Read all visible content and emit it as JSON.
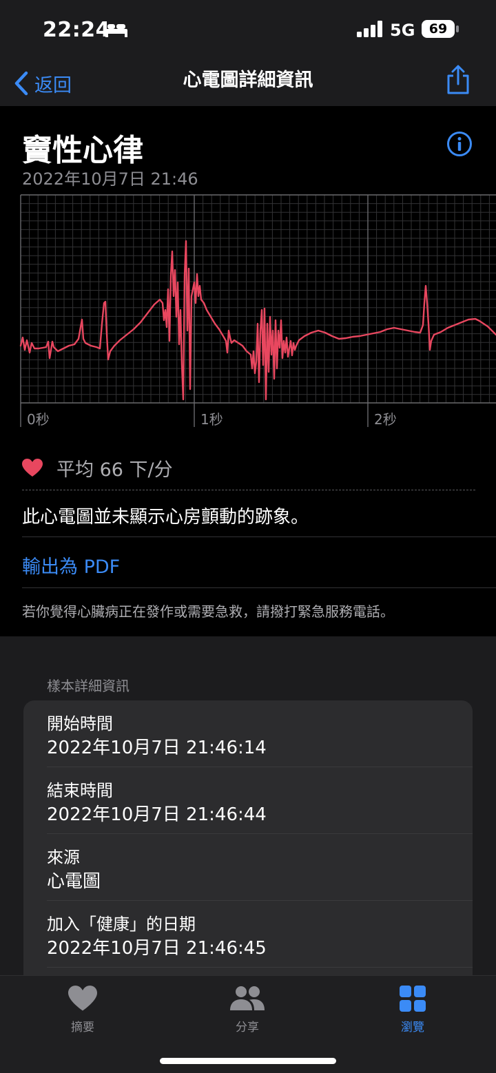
{
  "status_bar": {
    "time": "22:24",
    "network": "5G",
    "battery": "69"
  },
  "nav": {
    "back_label": "返回",
    "title": "心電圖詳細資訊"
  },
  "header": {
    "title": "竇性心律",
    "date": "2022年10月7日 21:46"
  },
  "chart": {
    "time_labels": [
      "0秒",
      "1秒",
      "2秒"
    ],
    "trace_color": "#e8475f",
    "grid_color": "#4a4a4c"
  },
  "summary": {
    "average": "平均 66 下/分",
    "classification": "此心電圖並未顯示心房顫動的跡象。",
    "export_pdf": "輸出為 PDF",
    "warning": "若你覺得心臟病正在發作或需要急救，請撥打緊急服務電話。"
  },
  "details": {
    "section_header": "樣本詳細資訊",
    "rows": [
      {
        "label": "開始時間",
        "value": "2022年10月7日 21:46:14"
      },
      {
        "label": "結束時間",
        "value": "2022年10月7日 21:46:44"
      },
      {
        "label": "來源",
        "value": "心電圖"
      },
      {
        "label": "加入「健康」的日期",
        "value": "2022年10月7日 21:46:45"
      }
    ]
  },
  "tabs": [
    {
      "label": "摘要",
      "icon": "heart-icon",
      "active": false
    },
    {
      "label": "分享",
      "icon": "people-icon",
      "active": false
    },
    {
      "label": "瀏覽",
      "icon": "grid-icon",
      "active": true
    }
  ],
  "colors": {
    "accent": "#3b8bf6",
    "heart": "#e8475f"
  }
}
